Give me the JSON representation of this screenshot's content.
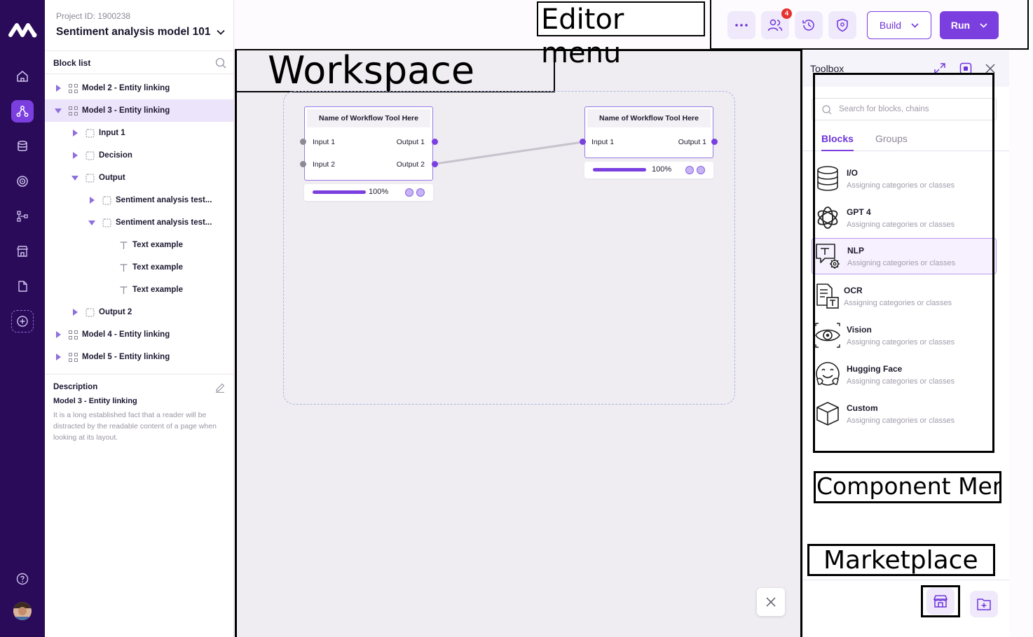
{
  "project": {
    "id_label": "Project ID: 1900238",
    "title": "Sentiment analysis model 101"
  },
  "block_list": {
    "heading": "Block list",
    "rows": [
      {
        "label": "Model 2 - Entity linking"
      },
      {
        "label": "Model 3 - Entity linking"
      },
      {
        "label": "Input 1"
      },
      {
        "label": "Decision"
      },
      {
        "label": "Output"
      },
      {
        "label": "Sentiment analysis test..."
      },
      {
        "label": "Sentiment analysis test..."
      },
      {
        "label": "Text example"
      },
      {
        "label": "Text example"
      },
      {
        "label": "Text example"
      },
      {
        "label": "Output 2"
      },
      {
        "label": "Model 4 - Entity linking"
      },
      {
        "label": "Model 5 - Entity linking"
      }
    ]
  },
  "description": {
    "heading": "Description",
    "title": "Model 3  - Entity linking",
    "body": "It is a long established fact that a reader will be distracted by the readable content of a page when looking at its layout."
  },
  "annotations": {
    "editor_menu": "Editor menu",
    "workspace": "Workspace",
    "component_menu": "Component Menu",
    "marketplace": "Marketplace"
  },
  "toolbar": {
    "collaborators_badge": "4",
    "build_label": "Build",
    "run_label": "Run"
  },
  "nodes": [
    {
      "title": "Name of Workflow Tool Here",
      "in1": "Input 1",
      "in2": "Input 2",
      "out1": "Output 1",
      "out2": "Output 2",
      "progress": 100,
      "progress_label": "100%"
    },
    {
      "title": "Name of Workflow Tool Here",
      "in1": "Input 1",
      "out1": "Output 1",
      "progress": 100,
      "progress_label": "100%"
    }
  ],
  "toolbox": {
    "title": "Toolbox",
    "search_placeholder": "Search for blocks, chains",
    "tabs": {
      "active": "Blocks",
      "inactive": "Groups"
    },
    "items": [
      {
        "name": "I/O",
        "desc": "Assigning categories or classes",
        "icon": "database-icon"
      },
      {
        "name": "GPT 4",
        "desc": "Assigning categories or classes",
        "icon": "openai-icon"
      },
      {
        "name": "NLP",
        "desc": "Assigning categories or classes",
        "icon": "nlp-icon"
      },
      {
        "name": "OCR",
        "desc": "Assigning categories or classes",
        "icon": "ocr-document-icon"
      },
      {
        "name": "Vision",
        "desc": "Assigning categories or classes",
        "icon": "eye-icon"
      },
      {
        "name": "Hugging Face",
        "desc": "Assigning categories or classes",
        "icon": "hugging-face-icon"
      },
      {
        "name": "Custom",
        "desc": "Assigning categories or classes",
        "icon": "cube-icon"
      }
    ]
  },
  "colors": {
    "rail": "#2a0b59",
    "accent": "#7b3fe0",
    "selected_row": "#ece4fb"
  }
}
